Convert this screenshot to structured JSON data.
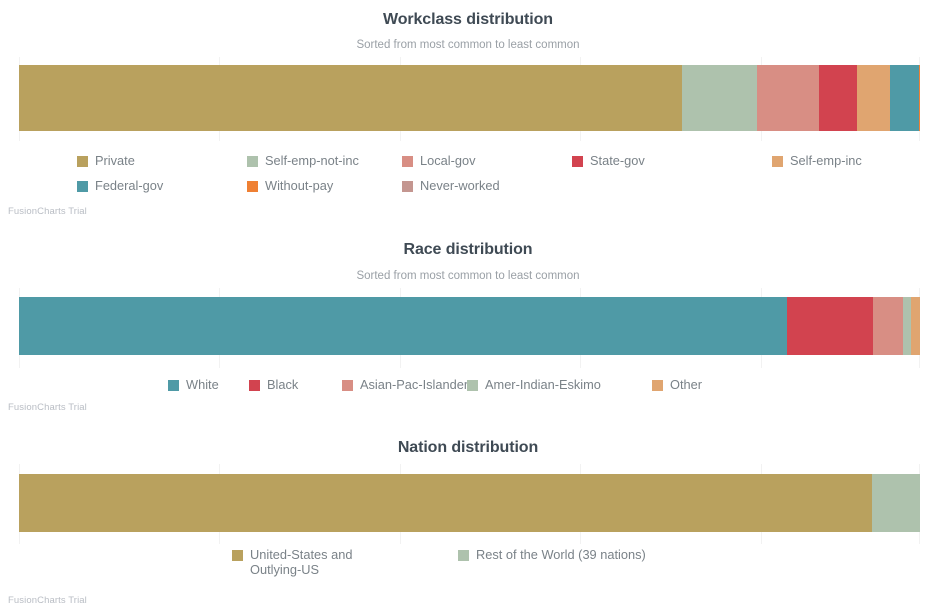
{
  "watermark": "FusionCharts Trial",
  "palette": {
    "gold": "#b9a15e",
    "sage": "#aec2ad",
    "salmon": "#d88e84",
    "red": "#d2434f",
    "peach": "#e0a570",
    "teal": "#4f9aa6",
    "orange": "#ef8033",
    "mauve": "#c49690",
    "title": "#3f4a54",
    "subtitle": "#9aa0a6",
    "legend_text": "#7a8288",
    "gridline": "#f2f2f2",
    "watermark": "#b9bdc4"
  },
  "charts": [
    {
      "id": "workclass",
      "title": "Workclass distribution",
      "subtitle": "Sorted from most common to least common",
      "chart_data": {
        "type": "bar",
        "orientation": "horizontal-stacked",
        "title": "Workclass distribution",
        "subtitle": "Sorted from most common to least common",
        "xlabel": "",
        "ylabel": "",
        "grid": true,
        "legend_position": "bottom",
        "categories": [
          "Private",
          "Self-emp-not-inc",
          "Local-gov",
          "State-gov",
          "Self-emp-inc",
          "Federal-gov",
          "Without-pay",
          "Never-worked"
        ],
        "colors": [
          "#b9a15e",
          "#aec2ad",
          "#d88e84",
          "#d2434f",
          "#e0a570",
          "#4f9aa6",
          "#ef8033",
          "#c49690"
        ],
        "values": [
          73.6,
          8.3,
          6.9,
          4.2,
          3.6,
          3.3,
          0.05,
          0.02
        ],
        "ylim": [
          0,
          100
        ]
      },
      "legend": [
        {
          "label": "Private",
          "color": "#b9a15e"
        },
        {
          "label": "Self-emp-not-inc",
          "color": "#aec2ad"
        },
        {
          "label": "Local-gov",
          "color": "#d88e84"
        },
        {
          "label": "State-gov",
          "color": "#d2434f"
        },
        {
          "label": "Self-emp-inc",
          "color": "#e0a570"
        },
        {
          "label": "Federal-gov",
          "color": "#4f9aa6"
        },
        {
          "label": "Without-pay",
          "color": "#ef8033"
        },
        {
          "label": "Never-worked",
          "color": "#c49690"
        }
      ]
    },
    {
      "id": "race",
      "title": "Race distribution",
      "subtitle": "Sorted from most common to least common",
      "chart_data": {
        "type": "bar",
        "orientation": "horizontal-stacked",
        "title": "Race distribution",
        "subtitle": "Sorted from most common to least common",
        "xlabel": "",
        "ylabel": "",
        "grid": true,
        "legend_position": "bottom",
        "categories": [
          "White",
          "Black",
          "Asian-Pac-Islander",
          "Amer-Indian-Eskimo",
          "Other"
        ],
        "colors": [
          "#4f9aa6",
          "#d2434f",
          "#d88e84",
          "#aec2ad",
          "#e0a570"
        ],
        "values": [
          85.3,
          9.6,
          3.3,
          0.9,
          1.0
        ],
        "ylim": [
          0,
          100
        ]
      },
      "legend": [
        {
          "label": "White",
          "color": "#4f9aa6"
        },
        {
          "label": "Black",
          "color": "#d2434f"
        },
        {
          "label": "Asian-Pac-Islander",
          "color": "#d88e84"
        },
        {
          "label": "Amer-Indian-Eskimo",
          "color": "#aec2ad"
        },
        {
          "label": "Other",
          "color": "#e0a570"
        }
      ]
    },
    {
      "id": "nation",
      "title": "Nation distribution",
      "subtitle": "",
      "chart_data": {
        "type": "bar",
        "orientation": "horizontal-stacked",
        "title": "Nation distribution",
        "subtitle": "",
        "xlabel": "",
        "ylabel": "",
        "grid": true,
        "legend_position": "bottom",
        "categories": [
          "United-States and Outlying-US",
          "Rest of the World (39 nations)"
        ],
        "colors": [
          "#b9a15e",
          "#aec2ad"
        ],
        "values": [
          94.7,
          5.3
        ],
        "ylim": [
          0,
          100
        ]
      },
      "legend": [
        {
          "label": "United-States and Outlying-US",
          "color": "#b9a15e"
        },
        {
          "label": "Rest of the World (39 nations)",
          "color": "#aec2ad"
        }
      ]
    }
  ]
}
